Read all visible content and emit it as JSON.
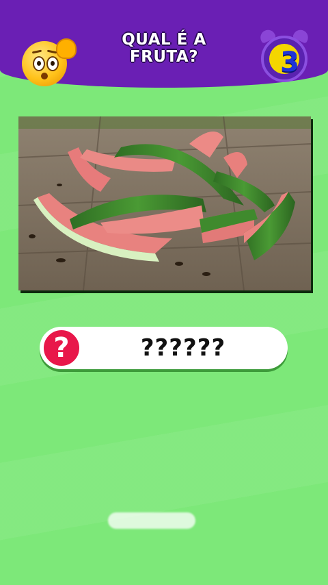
{
  "header": {
    "title": "QUAL É A FRUTA?",
    "emoji_icon": "thinking-face-emoji",
    "timer": {
      "icon": "alarm-clock-icon",
      "value": "3"
    },
    "colors": {
      "background": "#6a1fb4",
      "timer_digit": "#1f34d8",
      "timer_face": "#f4d600"
    }
  },
  "puzzle": {
    "image": "watermelon-rinds-photo",
    "answer_icon": "question-mark-icon",
    "answer_text": "??????"
  },
  "colors": {
    "page_background": "#7de879",
    "answer_icon_bg": "#e8174a"
  }
}
